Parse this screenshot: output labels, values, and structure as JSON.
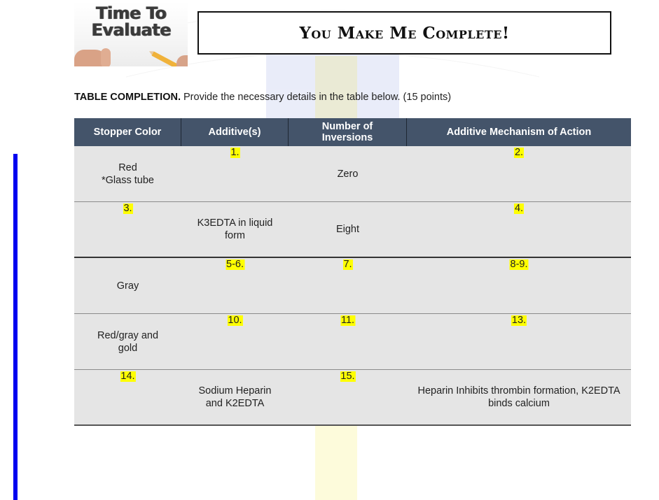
{
  "header": {
    "image_caption_lines": [
      "Time To",
      "Evaluate"
    ],
    "title": "You Make Me Complete!"
  },
  "instructions": {
    "bold": "TABLE COMPLETION.",
    "text": " Provide the necessary details in the table below. (15 points)"
  },
  "table": {
    "columns": [
      "Stopper Color",
      "Additive(s)",
      "Number of Inversions",
      "Additive Mechanism of Action"
    ],
    "rows": [
      {
        "stopper": {
          "blank": "",
          "value": "Red\n*Glass tube"
        },
        "additive": {
          "blank": "1.",
          "value": ""
        },
        "inversions": {
          "blank": "",
          "value": "Zero"
        },
        "mechanism": {
          "blank": "2.",
          "value": ""
        }
      },
      {
        "stopper": {
          "blank": "3.",
          "value": ""
        },
        "additive": {
          "blank": "",
          "value": "K3EDTA in liquid form"
        },
        "inversions": {
          "blank": "",
          "value": "Eight"
        },
        "mechanism": {
          "blank": "4.",
          "value": ""
        }
      },
      {
        "stopper": {
          "blank": "",
          "value": "Gray"
        },
        "additive": {
          "blank": "5-6.",
          "value": ""
        },
        "inversions": {
          "blank": "7.",
          "value": ""
        },
        "mechanism": {
          "blank": "8-9.",
          "value": ""
        }
      },
      {
        "stopper": {
          "blank": "",
          "value": "Red/gray and gold"
        },
        "additive": {
          "blank": "10.",
          "value": ""
        },
        "inversions": {
          "blank": "11.",
          "value": ""
        },
        "mechanism": {
          "blank": "13.",
          "value": ""
        }
      },
      {
        "stopper": {
          "blank": "14.",
          "value": ""
        },
        "additive": {
          "blank": "",
          "value": "Sodium Heparin and K2EDTA"
        },
        "inversions": {
          "blank": "15.",
          "value": ""
        },
        "mechanism": {
          "blank": "",
          "value": "Heparin Inhibits thrombin formation, K2EDTA binds calcium"
        }
      }
    ]
  },
  "colors": {
    "table_header": "#44546a",
    "row_fill": "#e5e5e5",
    "blank_highlight": "#ffff00",
    "left_bar": "#0000f0"
  }
}
